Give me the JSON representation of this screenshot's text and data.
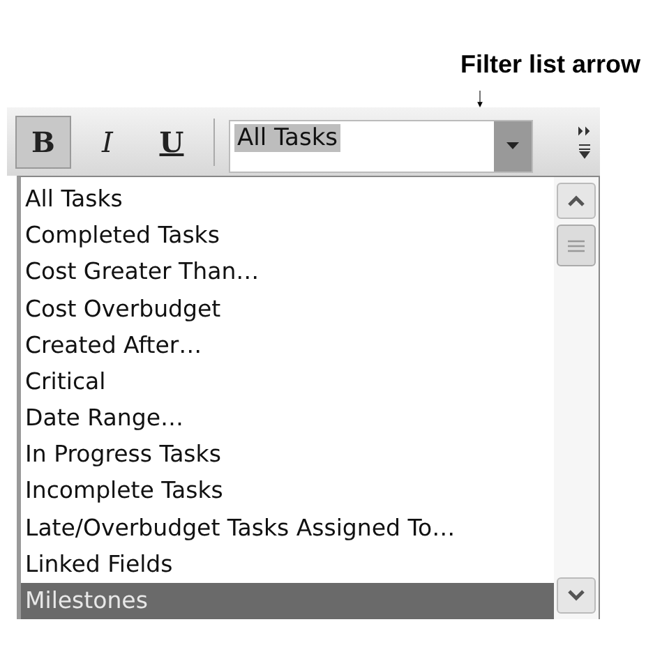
{
  "callout": {
    "label": "Filter list arrow"
  },
  "toolbar": {
    "buttons": [
      {
        "label": "B",
        "kind": "bold",
        "selected": true
      },
      {
        "label": "I",
        "kind": "italic",
        "selected": false
      },
      {
        "label": "U",
        "kind": "underline",
        "selected": false
      }
    ],
    "filter": {
      "value": "All Tasks"
    }
  },
  "list": {
    "items": [
      {
        "label": "All Tasks",
        "selected": false
      },
      {
        "label": "Completed Tasks",
        "selected": false
      },
      {
        "label": "Cost Greater Than…",
        "selected": false
      },
      {
        "label": "Cost Overbudget",
        "selected": false
      },
      {
        "label": "Created After…",
        "selected": false
      },
      {
        "label": "Critical",
        "selected": false
      },
      {
        "label": "Date Range…",
        "selected": false
      },
      {
        "label": "In Progress Tasks",
        "selected": false
      },
      {
        "label": "Incomplete Tasks",
        "selected": false
      },
      {
        "label": "Late/Overbudget Tasks Assigned To…",
        "selected": false
      },
      {
        "label": "Linked Fields",
        "selected": false
      },
      {
        "label": "Milestones",
        "selected": true
      }
    ]
  }
}
